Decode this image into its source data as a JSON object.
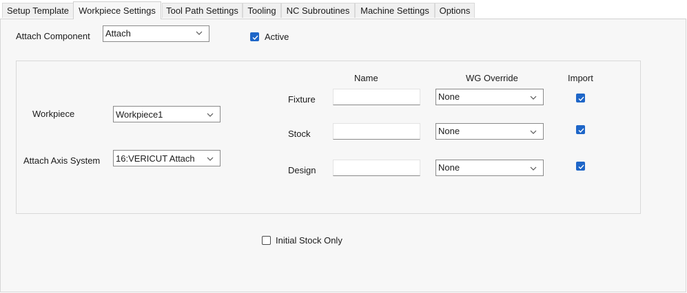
{
  "tabs": [
    {
      "label": "Setup Template",
      "active": false
    },
    {
      "label": "Workpiece Settings",
      "active": true
    },
    {
      "label": "Tool Path Settings",
      "active": false
    },
    {
      "label": "Tooling",
      "active": false
    },
    {
      "label": "NC Subroutines",
      "active": false
    },
    {
      "label": "Machine Settings",
      "active": false
    },
    {
      "label": "Options",
      "active": false
    }
  ],
  "attach_component": {
    "label": "Attach Component",
    "value": "Attach"
  },
  "active": {
    "label": "Active",
    "checked": true
  },
  "workpiece": {
    "label": "Workpiece",
    "value": "Workpiece1"
  },
  "attach_axis": {
    "label": "Attach Axis System",
    "value": "16:VERICUT Attach"
  },
  "columns": {
    "name": "Name",
    "wg_override": "WG Override",
    "import": "Import"
  },
  "rows": [
    {
      "label": "Fixture",
      "name": "",
      "override": "None",
      "import": true
    },
    {
      "label": "Stock",
      "name": "",
      "override": "None",
      "import": true
    },
    {
      "label": "Design",
      "name": "",
      "override": "None",
      "import": true
    }
  ],
  "initial_stock_only": {
    "label": "Initial Stock Only",
    "checked": false
  },
  "colors": {
    "accent": "#1e66c8",
    "panel": "#f7f7f7",
    "border": "#d6d6d6"
  },
  "icons": {
    "dropdown": "chevron-down-icon",
    "check": "check-icon"
  }
}
